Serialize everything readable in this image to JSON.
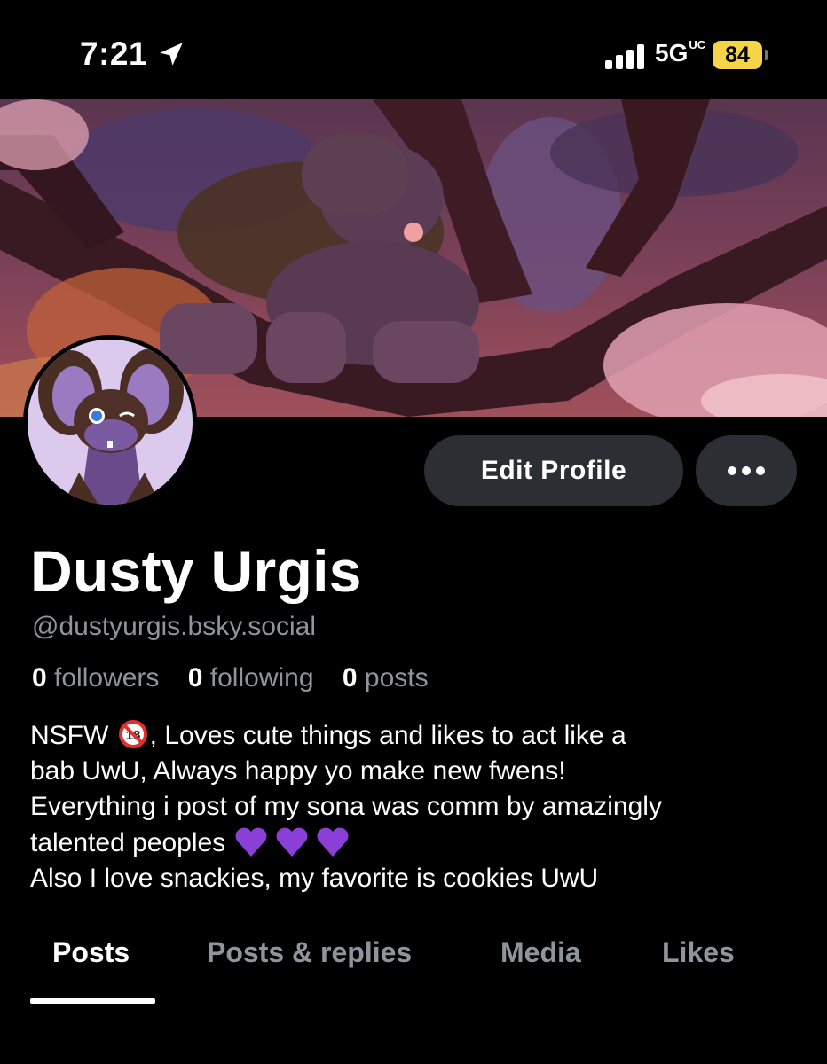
{
  "status_bar": {
    "time": "7:21",
    "network": "5G",
    "network_sup": "UC",
    "battery": "84",
    "icons": [
      "location-arrow-icon",
      "signal-bars-icon",
      "battery-icon"
    ]
  },
  "profile": {
    "display_name": "Dusty Urgis",
    "handle": "@dustyurgis.bsky.social",
    "stats": [
      {
        "count": "0",
        "label": "followers"
      },
      {
        "count": "0",
        "label": "following"
      },
      {
        "count": "0",
        "label": "posts"
      }
    ],
    "bio": {
      "line1_a": "NSFW ",
      "line1_b": ", Loves cute things and likes to act like a",
      "line2": "bab UwU, Always happy yo make new fwens!",
      "line3": "Everything i post of my sona was comm by amazingly",
      "line4": "talented peoples ",
      "line5": "Also I love snackies, my favorite is cookies UwU",
      "emoji": [
        "no-one-under-eighteen-icon",
        "purple-heart-icon",
        "purple-heart-icon",
        "purple-heart-icon"
      ]
    }
  },
  "actions": {
    "edit_profile": "Edit Profile",
    "more_icon": "more-dots-icon"
  },
  "tabs": [
    {
      "label": "Posts",
      "active": true
    },
    {
      "label": "Posts & replies",
      "active": false
    },
    {
      "label": "Media",
      "active": false
    },
    {
      "label": "Likes",
      "active": false
    }
  ],
  "colors": {
    "background": "#000000",
    "button_bg": "#2b2e33",
    "muted_text": "#8f959d",
    "battery": "#f5d547",
    "heart": "#8a3fd6"
  }
}
